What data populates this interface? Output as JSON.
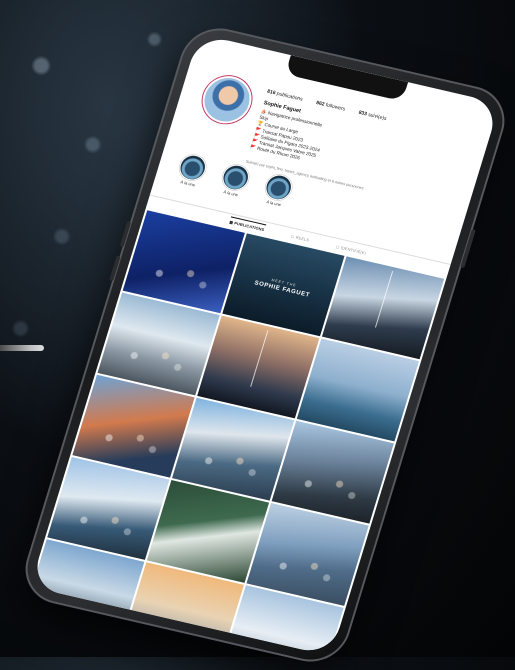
{
  "profile": {
    "publications": "816",
    "publications_label": "publications",
    "followers": "862",
    "followers_label": "followers",
    "following": "833",
    "following_label": "suivi(e)s",
    "name": "Sophie Faguet",
    "bio": [
      "⛵ Navigatrice professionnelle",
      "Skip",
      "🏆 Course au Large",
      "🚩 Transat Papou 2023",
      "🚩 Solitaire du Figaro 2023-2024",
      "🚩 Transat Jacques Vabre 2025",
      "🚩 Route du Rhum 2026"
    ],
    "followed_by": "Suivi(e) par sophi_fino, topics_agency, koifsailing et 6 autres personnes"
  },
  "highlights": [
    {
      "label": "À la une"
    },
    {
      "label": "À la une"
    },
    {
      "label": "À la une"
    }
  ],
  "tabs": {
    "publications": "▦ PUBLICATIONS",
    "reels": "▷ REELS",
    "identified": "◻ IDENTIFIÉ(E)"
  },
  "posts": [
    {
      "caption_small": "",
      "caption": ""
    },
    {
      "caption_small": "MEET THE",
      "caption": "SOPHIE FAGUET"
    },
    {
      "caption_small": "",
      "caption": ""
    },
    {
      "caption_small": "",
      "caption": ""
    },
    {
      "caption_small": "",
      "caption": ""
    },
    {
      "caption_small": "",
      "caption": ""
    },
    {
      "caption_small": "",
      "caption": ""
    },
    {
      "caption_small": "",
      "caption": ""
    },
    {
      "caption_small": "",
      "caption": ""
    },
    {
      "caption_small": "",
      "caption": ""
    },
    {
      "caption_small": "",
      "caption": ""
    },
    {
      "caption_small": "",
      "caption": ""
    },
    {
      "caption_small": "",
      "caption": ""
    },
    {
      "caption_small": "",
      "caption": ""
    },
    {
      "caption_small": "",
      "caption": ""
    }
  ],
  "colors": {
    "brand_blue": "#1a3fa0",
    "avatar_ring": "#c23d6b",
    "frame": "#1a1b1d"
  }
}
